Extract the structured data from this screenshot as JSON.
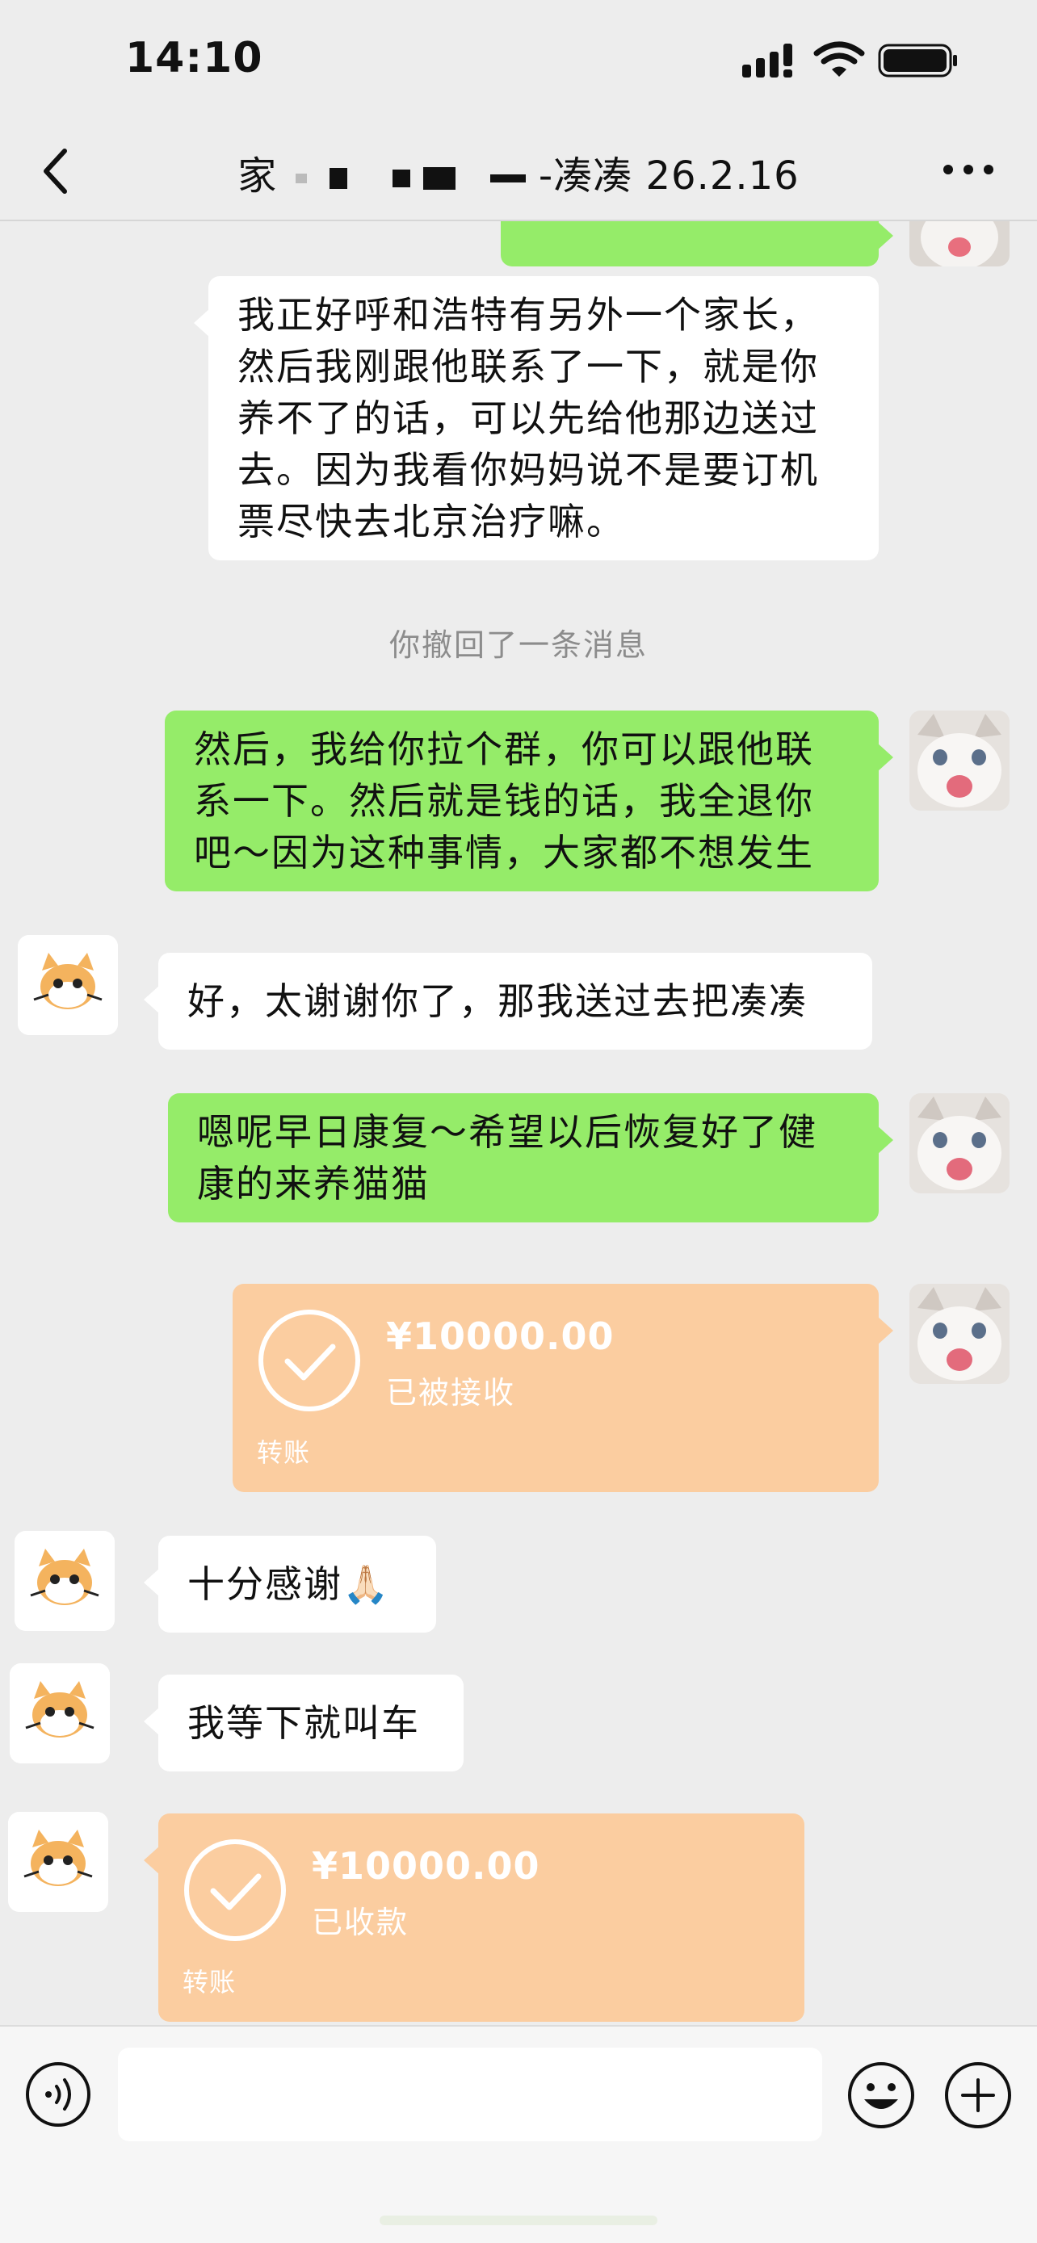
{
  "status_bar": {
    "time": "14:10",
    "icons": [
      "cellular-signal-icon",
      "wifi-icon",
      "battery-icon"
    ]
  },
  "nav": {
    "title_prefix": "家",
    "title_suffix": "-凑凑 26.2.16",
    "icons": [
      "back-icon",
      "more-icon"
    ]
  },
  "messages": {
    "m1_text": "我正好呼和浩特有另外一个家长，然后我刚跟他联系了一下，就是你养不了的话，可以先给他那边送过去。因为我看你妈妈说不是要订机票尽快去北京治疗嘛。",
    "system_recall": "你撤回了一条消息",
    "m2_text": "然后，我给你拉个群，你可以跟他联系一下。然后就是钱的话，我全退你吧～因为这种事情，大家都不想发生",
    "m3_text": "好，太谢谢你了，那我送过去把凑凑",
    "m4_text": "嗯呢早日康复～希望以后恢复好了健康的来养猫猫",
    "transfer1": {
      "amount": "¥10000.00",
      "status": "已被接收",
      "label": "转账"
    },
    "m5_text": "十分感谢🙏🏻",
    "m6_text": "我等下就叫车",
    "transfer2": {
      "amount": "¥10000.00",
      "status": "已收款",
      "label": "转账"
    }
  },
  "input_bar": {
    "placeholder": "",
    "icons": [
      "voice-icon",
      "emoji-icon",
      "plus-icon"
    ]
  },
  "colors": {
    "background": "#ededed",
    "self_bubble": "#95ec69",
    "other_bubble": "#ffffff",
    "transfer_bubble": "#fbcda0"
  }
}
